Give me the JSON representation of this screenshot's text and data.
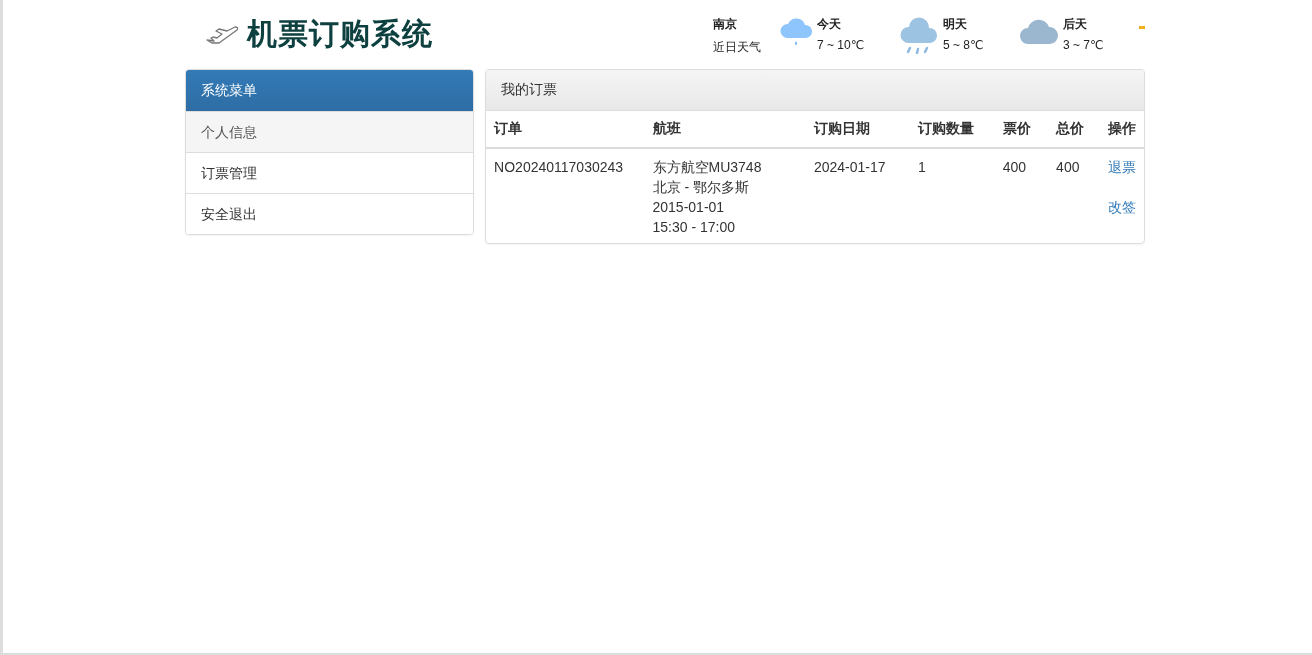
{
  "header": {
    "title": "机票订购系统",
    "weather": {
      "city": "南京",
      "caption": "近日天气",
      "days": [
        {
          "label": "今天",
          "temp": "7 ~ 10℃",
          "kind": "light-rain"
        },
        {
          "label": "明天",
          "temp": "5 ~ 8℃",
          "kind": "rain"
        },
        {
          "label": "后天",
          "temp": "3 ~ 7℃",
          "kind": "cloudy"
        }
      ]
    }
  },
  "sidebar": {
    "title": "系统菜单",
    "items": [
      {
        "label": "个人信息",
        "selected": true
      },
      {
        "label": "订票管理",
        "selected": false
      },
      {
        "label": "安全退出",
        "selected": false
      }
    ]
  },
  "panel": {
    "title": "我的订票",
    "table": {
      "columns": [
        "订单",
        "航班",
        "订购日期",
        "订购数量",
        "票价",
        "总价",
        "操作"
      ],
      "rows": [
        {
          "order": "NO20240117030243",
          "flight": [
            "东方航空MU3748",
            "北京 - 鄂尔多斯",
            "2015-01-01",
            "15:30 - 17:00"
          ],
          "date": "2024-01-17",
          "quantity": "1",
          "price": "400",
          "total": "400",
          "actions": [
            "退票",
            "改签"
          ]
        }
      ]
    }
  }
}
